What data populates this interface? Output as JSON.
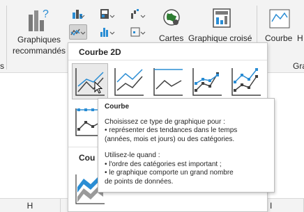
{
  "ribbon": {
    "recommended_charts_label": [
      "Graphiques",
      "recommandés"
    ],
    "maps_label": "Cartes",
    "pivot_chart_label": "Graphique croisé",
    "sparkline_line_label": "Courbe",
    "sparkline_cut_label": "H",
    "group_left_cut": "s",
    "group_right_cut": "Gra"
  },
  "dropdown": {
    "section_2d": "Courbe 2D",
    "section_3d_partial": "Cou",
    "charts": [
      {
        "name": "Courbe"
      },
      {
        "name": "Courbe empilée"
      },
      {
        "name": "Courbe empilée 100 %"
      },
      {
        "name": "Courbe avec marqueurs"
      },
      {
        "name": "Courbe empilée avec marqueurs"
      },
      {
        "name": "Courbe empilée 100 % avec marqueurs"
      },
      {
        "name": "Courbe 3D"
      }
    ]
  },
  "tooltip": {
    "title": "Courbe",
    "lines_a": [
      "Choisissez ce type de graphique pour :",
      "• représenter des tendances dans le temps",
      "(années, mois et jours) ou des catégories."
    ],
    "lines_b": [
      "Utilisez-le quand :",
      "• l'ordre des catégories est important ;",
      "• le graphique comporte un grand nombre",
      "de points de données."
    ]
  },
  "columns": [
    "H",
    "I"
  ],
  "colors": {
    "accent_blue": "#2a8dd4",
    "line_gray": "#404040",
    "ribbon_bg": "#f3f3f3"
  }
}
